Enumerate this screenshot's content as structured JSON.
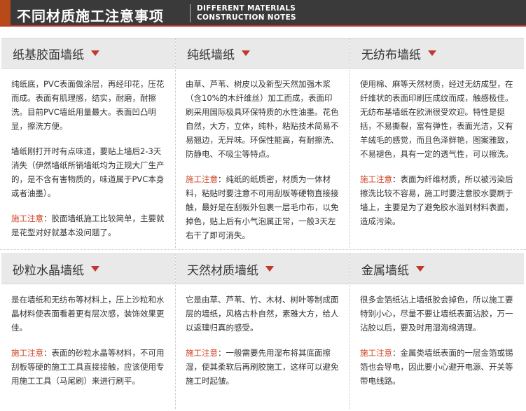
{
  "header": {
    "title": "不同材质施工注意事项",
    "en_line1": "DIFFERENT MATERIALS",
    "en_line2": "CONSTRUCTION NOTES"
  },
  "note_label": "施工注意",
  "cards": [
    {
      "title": "纸基胶面墙纸",
      "p1": "纯纸底，PVC表面做涂层，再经印花，压花而成。表面有肌理感，结实，耐磨，耐擦洗。目前PVC墙纸用量最大。表面凹凸明显，擦洗方便。",
      "p2": "墙纸刚打开时有点味道，要贴上墙后2-3天消失（伊然墙纸所销墙纸均为正规大厂生产的，是不含有害物质的，味道属于PVC本身或者油墨）。",
      "note": "：胶面墙纸施工比较简单，主要就是花型对好就基本没问题了。"
    },
    {
      "title": "纯纸墙纸",
      "p1": "由草、芦苇、树皮以及新型天然加强木浆（含10%的木纤维丝）加工而成，表面印刷采用国际极具环保特质的水性油墨。花色自然，大方，立体，纯朴，粘贴技术简易不易翘边，无异味。环保性能高，有耐擦洗、防静电、不吸尘等特点。",
      "p2": "",
      "note": "：纯纸的纸质密，材质为一体材料，粘贴时要注意不可用刮板等硬物直接接触，最好是在刮板外包裹一层毛巾布，以免掉色，贴上后有小气泡属正常，一般3天左右干了即可消失。"
    },
    {
      "title": "无纺布墙纸",
      "p1": "使用棉、麻等天然材质，经过无纺成型，在纤维状的表面印刷压成纹而成，触感极佳。无纺布基墙纸在欧洲很受欢迎。特性是挺括，不易撕裂，富有弹性，表面光洁，又有羊绒毛的感觉，而且色泽鲜艳，图案雅致，不易褪色，具有一定的透气性，可以擦洗。",
      "p2": "",
      "note": "：表面为纤维材质，所以被污染后擦洗比较不容易，施工时要注意胶水要刷于墙上，主要是为了避免胶水溢到材料表面，造成污染。"
    },
    {
      "title": "砂粒水晶墙纸",
      "p1": "是在墙纸和无纺布等材料上，压上沙粒和水晶材料使表面看着更有层次感，装饰效果更佳。",
      "p2": "",
      "note": "：表面的砂粒水晶等材料，不可用刮板等硬的施工工具直接接触，应该使用专用施工工具（马尾刷）来进行刷平。"
    },
    {
      "title": "天然材质墙纸",
      "p1": "它是由草、芦苇、竹、木材、树叶等制成面层的墙纸，风格古朴自然，素雅大方，给人以返璞归真的感受。",
      "p2": "",
      "note": "：一般需要先用湿布将其底面擦湿，使其柔软后再刷胶施工，这样可以避免施工时起皱。"
    },
    {
      "title": "金属墙纸",
      "p1": "很多金箔纸沾上墙纸胶会掉色，所以施工要特别小心，尽量不要让墙纸表面沾胶，万一沾胶以后，要及时用湿海绵清理。",
      "p2": "",
      "note": "：金属类墙纸表面的一层金箔或锡箔也会导电，因此要小心避开电源、开关等带电线路。"
    }
  ]
}
